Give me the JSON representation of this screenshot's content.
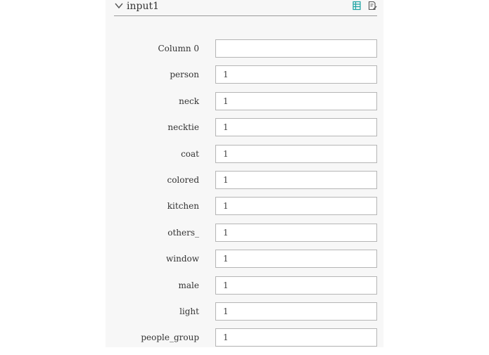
{
  "panel": {
    "title": "input1",
    "icons": {
      "collapse": "chevron-down-icon",
      "table": "table-view-icon",
      "edit": "edit-document-icon"
    },
    "accent_color": "#1aa3a3"
  },
  "fields": [
    {
      "label": "Column 0",
      "value": ""
    },
    {
      "label": "person",
      "value": "1"
    },
    {
      "label": "neck",
      "value": "1"
    },
    {
      "label": "necktie",
      "value": "1"
    },
    {
      "label": "coat",
      "value": "1"
    },
    {
      "label": "colored",
      "value": "1"
    },
    {
      "label": "kitchen",
      "value": "1"
    },
    {
      "label": "others_",
      "value": "1"
    },
    {
      "label": "window",
      "value": "1"
    },
    {
      "label": "male",
      "value": "1"
    },
    {
      "label": "light",
      "value": "1"
    },
    {
      "label": "people_group",
      "value": "1"
    }
  ]
}
